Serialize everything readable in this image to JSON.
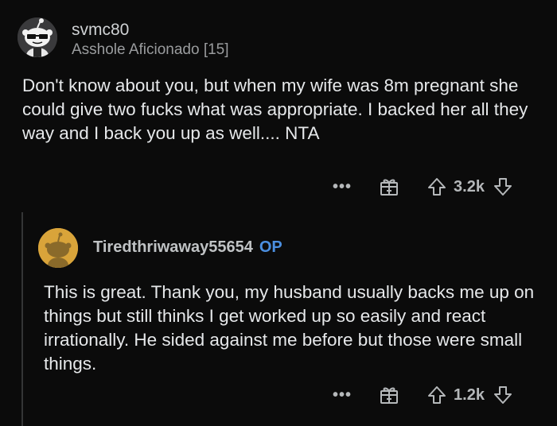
{
  "comment": {
    "username": "svmc80",
    "flair": "Asshole Aficionado [15]",
    "body": "Don't know about you, but when my wife was 8m pregnant she could give two fucks what was appropriate. I backed her all they way and I back you up as well.... NTA",
    "score": "3.2k",
    "more_label": "•••"
  },
  "reply": {
    "username": "Tiredthriwaway55654",
    "op_badge": "OP",
    "body": "This is great. Thank you, my husband usually backs me up on things but still thinks I get worked up so easily and react irrationally. He sided against me before but those were small things.",
    "score": "1.2k",
    "more_label": "•••"
  },
  "colors": {
    "background": "#0b0b0b",
    "op_badge": "#4b8fe0",
    "reply_avatar": "#d9a43a"
  },
  "icons": [
    "snoo-sunglasses-avatar-icon",
    "snoo-avatar-icon",
    "more-icon",
    "award-gift-icon",
    "upvote-arrow-icon",
    "downvote-arrow-icon"
  ]
}
